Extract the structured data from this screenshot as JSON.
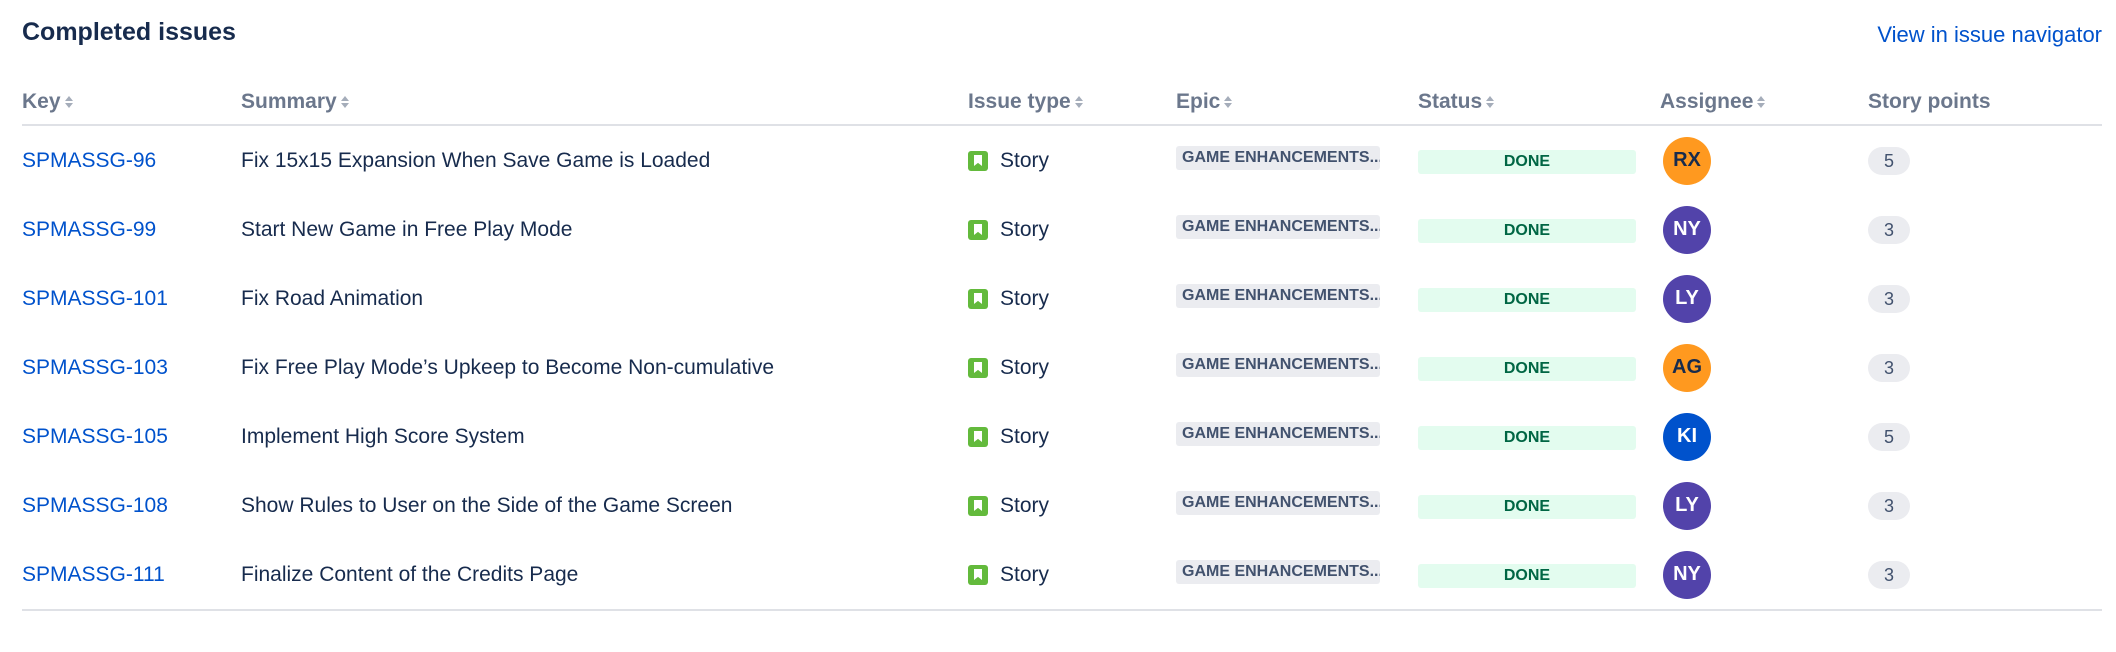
{
  "header": {
    "title": "Completed issues",
    "navigator_link": "View in issue navigator"
  },
  "columns": {
    "key": "Key",
    "summary": "Summary",
    "type": "Issue type",
    "epic": "Epic",
    "status": "Status",
    "assignee": "Assignee",
    "points": "Story points"
  },
  "issues": [
    {
      "key": "SPMASSG-96",
      "summary": "Fix 15x15 Expansion When Save Game is Loaded",
      "type": "Story",
      "epic": "GAME ENHANCEMENTS...",
      "status": "DONE",
      "assignee": "RX",
      "avatar_bg": "#ff991f",
      "avatar_fg": "#172b4d",
      "points": "5"
    },
    {
      "key": "SPMASSG-99",
      "summary": "Start New Game in Free Play Mode",
      "type": "Story",
      "epic": "GAME ENHANCEMENTS...",
      "status": "DONE",
      "assignee": "NY",
      "avatar_bg": "#5243aa",
      "avatar_fg": "#ffffff",
      "points": "3"
    },
    {
      "key": "SPMASSG-101",
      "summary": "Fix Road Animation",
      "type": "Story",
      "epic": "GAME ENHANCEMENTS...",
      "status": "DONE",
      "assignee": "LY",
      "avatar_bg": "#5243aa",
      "avatar_fg": "#ffffff",
      "points": "3"
    },
    {
      "key": "SPMASSG-103",
      "summary": "Fix Free Play Mode’s Upkeep to Become Non-cumulative",
      "type": "Story",
      "epic": "GAME ENHANCEMENTS...",
      "status": "DONE",
      "assignee": "AG",
      "avatar_bg": "#ff991f",
      "avatar_fg": "#172b4d",
      "points": "3"
    },
    {
      "key": "SPMASSG-105",
      "summary": "Implement High Score System",
      "type": "Story",
      "epic": "GAME ENHANCEMENTS...",
      "status": "DONE",
      "assignee": "KI",
      "avatar_bg": "#0052cc",
      "avatar_fg": "#ffffff",
      "points": "5"
    },
    {
      "key": "SPMASSG-108",
      "summary": "Show Rules to User on the Side of the Game Screen",
      "type": "Story",
      "epic": "GAME ENHANCEMENTS...",
      "status": "DONE",
      "assignee": "LY",
      "avatar_bg": "#5243aa",
      "avatar_fg": "#ffffff",
      "points": "3"
    },
    {
      "key": "SPMASSG-111",
      "summary": "Finalize Content of the Credits Page",
      "type": "Story",
      "epic": "GAME ENHANCEMENTS...",
      "status": "DONE",
      "assignee": "NY",
      "avatar_bg": "#5243aa",
      "avatar_fg": "#ffffff",
      "points": "3"
    }
  ],
  "icons": {
    "issue_type": "story-icon",
    "sort": "sort-icon"
  },
  "colors": {
    "link": "#0052cc",
    "story_icon": "#63ba3c",
    "done_bg": "#e3fcef",
    "done_fg": "#006644"
  }
}
